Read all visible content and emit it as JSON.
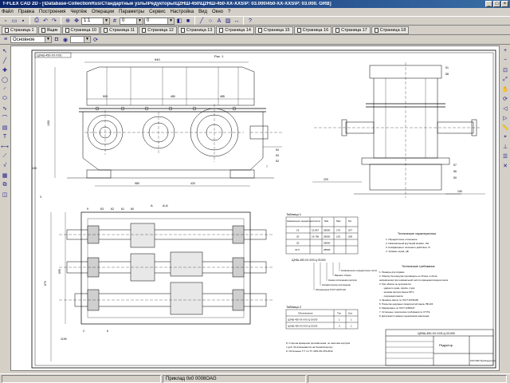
{
  "window": {
    "title": "T-FLEX CAD 2D - [\\Database-CollectionRus\\Стандартные узлы\\Редукторы\\Ц2НШ-450\\Ц2НШ-450-XX-XXS\\Р: 03.000\\450-XX-XXS\\Р: 03.000. GRB]",
    "min": "_",
    "max": "□",
    "close": "×"
  },
  "menu": [
    "Файл",
    "Правка",
    "Построения",
    "Чертёж",
    "Операции",
    "Параметры",
    "Сервис",
    "Настройка",
    "Вид",
    "Окно",
    "?"
  ],
  "toolbar": {
    "combo1": "1:1",
    "combo2": "0",
    "combo3": "0",
    "layer_combo": "Основное"
  },
  "page_tabs": [
    "Страница 1",
    "Ящик",
    "Страница 10",
    "Страница 11",
    "Страница 12",
    "Страница 13",
    "Страница 14",
    "Страница 15",
    "Страница 16",
    "Страница 17",
    "Страница 18"
  ],
  "status": {
    "left": "",
    "center": "Приклад 0x0 0008OAG"
  },
  "drawing": {
    "stamp_top": "Ц2НШ-450-XX-XXS",
    "fig1": "Рис. 1",
    "tables": {
      "t1_title": "Таблица 1",
      "t1_headers": [
        "Номинальное передаточное число",
        "i",
        "Nкв",
        "Mкр",
        "Мз"
      ],
      "t1_rows": [
        [
          "16",
          "15.857",
          "28500",
          "176",
          "207"
        ],
        [
          "20",
          "19.786",
          "28500",
          "135",
          "208"
        ],
        [
          "25",
          "",
          "28500",
          "",
          ""
        ],
        [
          "31.5",
          "",
          "28500",
          "",
          ""
        ]
      ],
      "t1_code": "Ц2НШ-450-XX-XXS-Ц 03.000",
      "t1_notes": [
        "Номинальное передаточное число",
        "Вариант сборки",
        "Номер исполнения корпуса",
        "Климатическое исполнение",
        "Обозначение ГОСТ 20373-94"
      ],
      "t2_title": "Таблица 2",
      "t2_headers": [
        "Обозначение",
        "Тип",
        "Кол."
      ],
      "t2_rows": [
        [
          "Ц2НШ-450-XX-XXS-Ц 03.000",
          "1",
          "1"
        ],
        [
          "Ц2НШ-450-XX-XXS-Ц 03.000",
          "2",
          "1"
        ]
      ]
    },
    "tech_title": "Технические характеристики",
    "tech_items": [
      "1. Передаточное отношение",
      "2. Номинальный крутящий момент, Нм",
      "3. Коэффициент полезного действия, %",
      "4. Уровень шума, дБ"
    ],
    "req_title": "Технические требования",
    "req_items": [
      "1. Размеры для справок.",
      "2. Обкатку без нагрузки производить не 30 мин. в обоих",
      "направлениях при номинальной частоте вращения входного вала.",
      "3. При обкатке не допускается:",
      "- ударного шума, скрипа, стука;",
      "- нагрева корпуса свыше 60°С;",
      "- подтекания масла.",
      "4. Заливать масло по ГОСТ 20799-88.",
      "5. Покрытие наружных поверхностей эмаль ПФ-115.",
      "6. Маркировать по ГОСТ 12969-67.",
      "7. Остальные технические требования по СТ РЭ.",
      "8. Допускается замена подшипников аналогами."
    ],
    "note_block": [
      "8. Сторона вращения произвольная, по наличию корпуса",
      "с доб. (5) вписываются на боковой корпус",
      "9. Остальные Т.Т. по ТУ 4161-56-479-2012"
    ],
    "stamp": {
      "code": "Ц2НШ-450-XX-XXS-Ц 03.000",
      "name": "Редуктор",
      "firm": "ОАО КМЗ Трубоиндустрия"
    },
    "dims": {
      "d940": "940",
      "d500": "500",
      "d480": "480",
      "d485": "485",
      "d1195": "1195",
      "d980": "980",
      "d420": "420",
      "d105": "105",
      "d1061": "1061",
      "d690": "690",
      "d875": "875",
      "d220": "220",
      "d190": "190",
      "d51": "51",
      "d58": "58",
      "d57": "57",
      "d56": "56",
      "d54": "54",
      "d53": "53",
      "d52": "52",
      "d50": "50",
      "d3": "3",
      "d7": "7",
      "d63": "63",
      "d62": "62",
      "d61": "61",
      "d60": "60",
      "d9": "9",
      "d2": "2",
      "d6": "6",
      "sect": "А-А",
      "lblA": "А"
    }
  }
}
